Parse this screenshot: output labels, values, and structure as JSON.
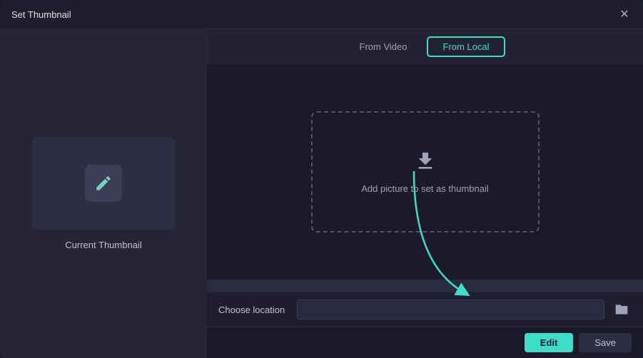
{
  "dialog": {
    "title": "Set Thumbnail",
    "close_label": "✕"
  },
  "left_panel": {
    "thumbnail_label": "Current Thumbnail",
    "edit_icon": "pencil-icon"
  },
  "tabs": {
    "from_video": "From Video",
    "from_local": "From Local",
    "active": "from_local"
  },
  "drop_zone": {
    "icon": "download-icon",
    "text": "Add picture to set as thumbnail"
  },
  "location": {
    "label": "Choose location",
    "placeholder": "",
    "folder_icon": "folder-icon"
  },
  "footer": {
    "edit_label": "Edit",
    "save_label": "Save"
  },
  "colors": {
    "accent": "#3dddc8"
  }
}
